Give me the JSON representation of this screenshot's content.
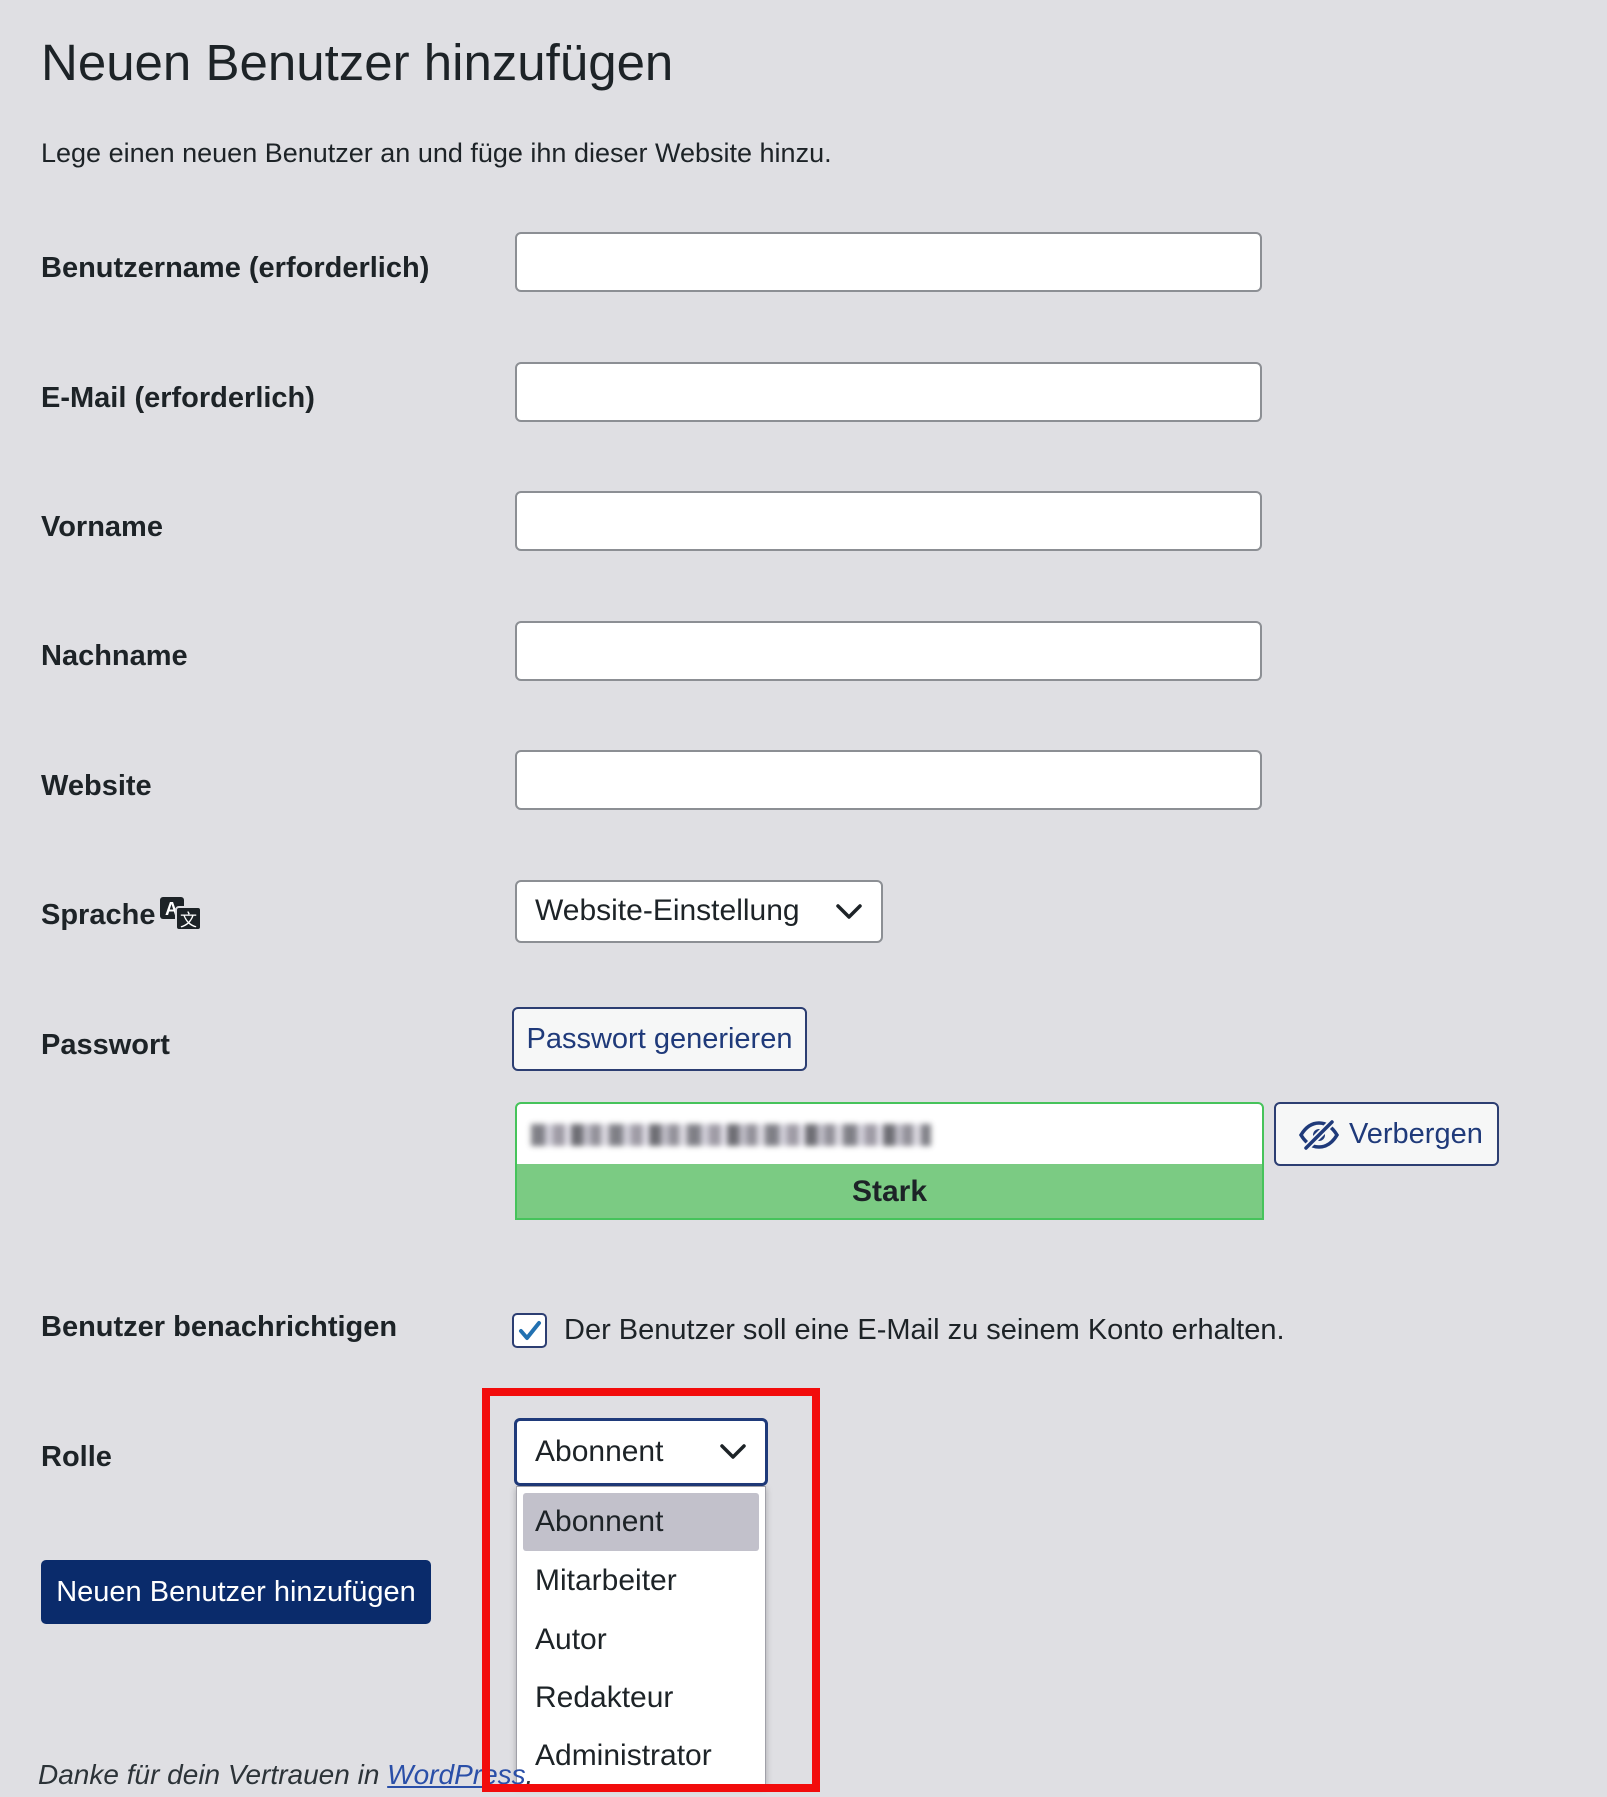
{
  "page": {
    "title": "Neuen Benutzer hinzufügen",
    "intro": "Lege einen neuen Benutzer an und füge ihn dieser Website hinzu."
  },
  "fields": {
    "username": {
      "label": "Benutzername (erforderlich)",
      "value": ""
    },
    "email": {
      "label": "E-Mail (erforderlich)",
      "value": ""
    },
    "firstname": {
      "label": "Vorname",
      "value": ""
    },
    "lastname": {
      "label": "Nachname",
      "value": ""
    },
    "website": {
      "label": "Website",
      "value": ""
    }
  },
  "language": {
    "label": "Sprache",
    "icon": "translate-icon",
    "selected": "Website-Einstellung"
  },
  "password": {
    "label": "Passwort",
    "generate_label": "Passwort generieren",
    "hide_label": "Verbergen",
    "hide_icon": "eye-slash-icon",
    "strength_label": "Stark",
    "strength_color": "#7bcb83"
  },
  "notify": {
    "label": "Benutzer benachrichtigen",
    "checkbox_label": "Der Benutzer soll eine E-Mail zu seinem Konto erhalten.",
    "checked": true
  },
  "role": {
    "label": "Rolle",
    "selected": "Abonnent",
    "options": [
      "Abonnent",
      "Mitarbeiter",
      "Autor",
      "Redakteur",
      "Administrator"
    ],
    "highlight_color": "#f20c0c"
  },
  "submit_label": "Neuen Benutzer hinzufügen",
  "footer": {
    "prefix": "Danke für dein Vertrauen in ",
    "link": "WordPress",
    "suffix": "."
  },
  "colors": {
    "background": "#dfdfe3",
    "primary": "#0a2b6b",
    "accent": "#1f3a7a"
  }
}
